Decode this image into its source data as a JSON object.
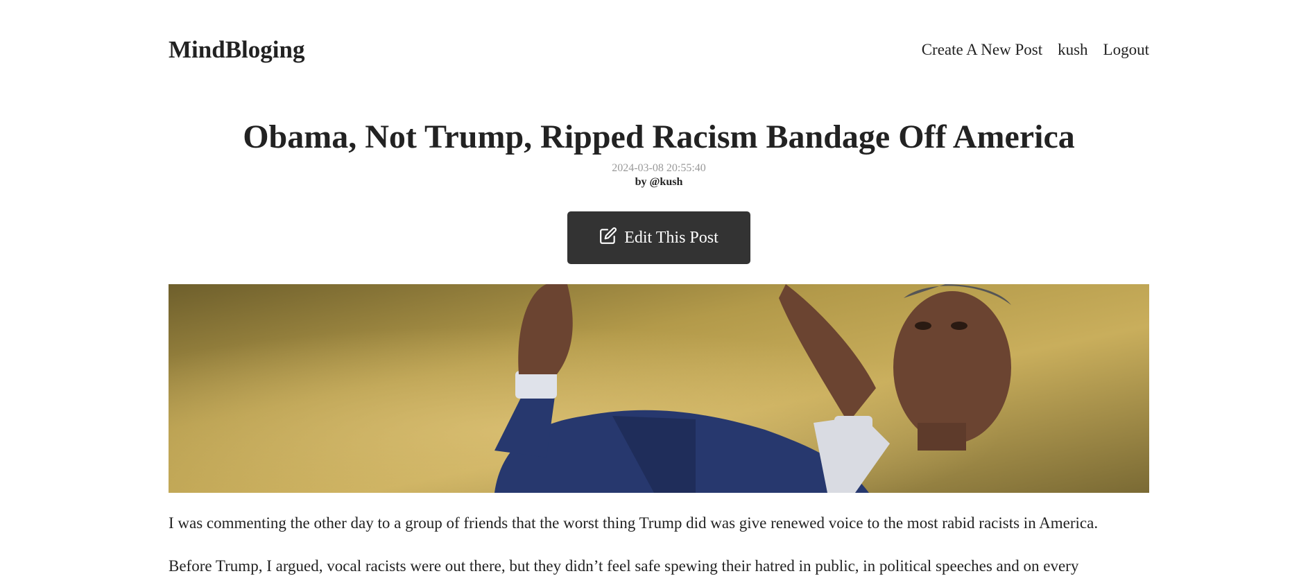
{
  "header": {
    "logo": "MindBloging",
    "nav": {
      "create_post": "Create A New Post",
      "username": "kush",
      "logout": "Logout"
    }
  },
  "post": {
    "title": "Obama, Not Trump, Ripped Racism Bandage Off America",
    "date": "2024-03-08 20:55:40",
    "author": "by @kush",
    "edit_label": "Edit This Post",
    "edit_icon": "edit-pencil-icon",
    "paragraphs": [
      "I was commenting the other day to a group of friends that the worst thing Trump did was give renewed voice to the most rabid racists in America.",
      "Before Trump, I argued, vocal racists were out there, but they didn’t feel safe spewing their hatred in public, in political speeches and on every"
    ]
  },
  "colors": {
    "text": "#222222",
    "muted": "#999999",
    "button_bg": "#333333",
    "button_text": "#ffffff"
  }
}
